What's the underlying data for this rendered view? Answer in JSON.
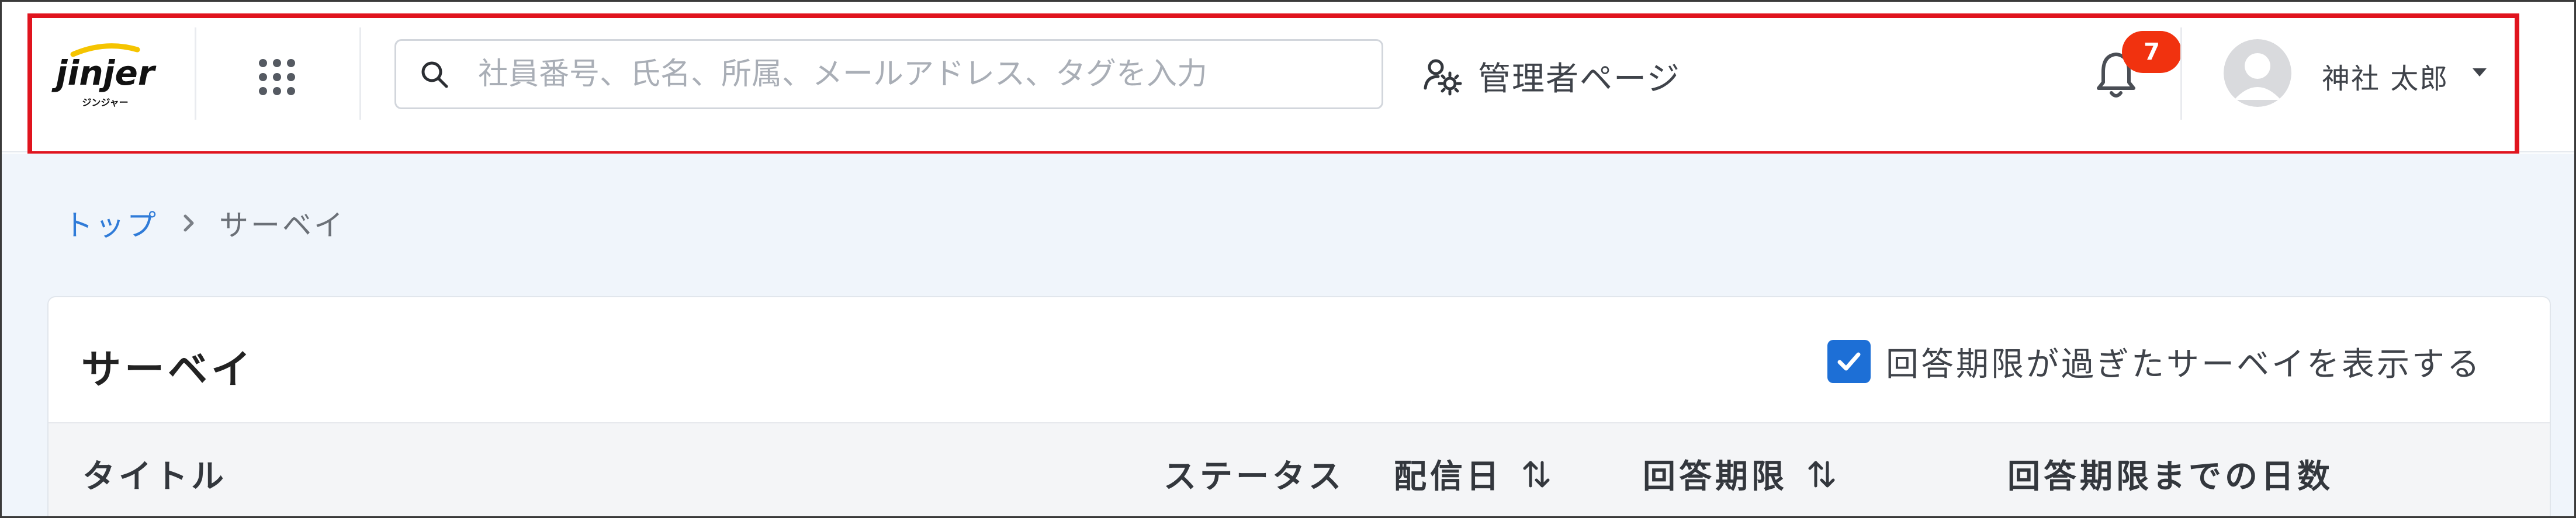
{
  "header": {
    "logo_text": "jinjer",
    "logo_subtext": "ジンジャー",
    "search": {
      "placeholder": "社員番号、氏名、所属、メールアドレス、タグを入力",
      "value": ""
    },
    "admin_label": "管理者ページ",
    "notification_count": "7",
    "user_name": "神社 太郎",
    "icons": [
      "apps-grid-icon",
      "search-icon",
      "admin-settings-icon",
      "bell-icon",
      "avatar-icon",
      "caret-down-icon"
    ]
  },
  "breadcrumb": {
    "home": "トップ",
    "current": "サーベイ"
  },
  "page": {
    "title": "サーベイ",
    "show_expired_label": "回答期限が過ぎたサーベイを表示する",
    "show_expired_checked": true
  },
  "table": {
    "columns": [
      "タイトル",
      "ステータス",
      "配信日",
      "回答期限",
      "回答期限までの日数"
    ]
  },
  "colors": {
    "accent": "#1d6fd6",
    "link": "#2f7bd8",
    "badge": "#f1320f",
    "highlight_border": "#e0141e",
    "logo_accent": "#f5c400"
  }
}
